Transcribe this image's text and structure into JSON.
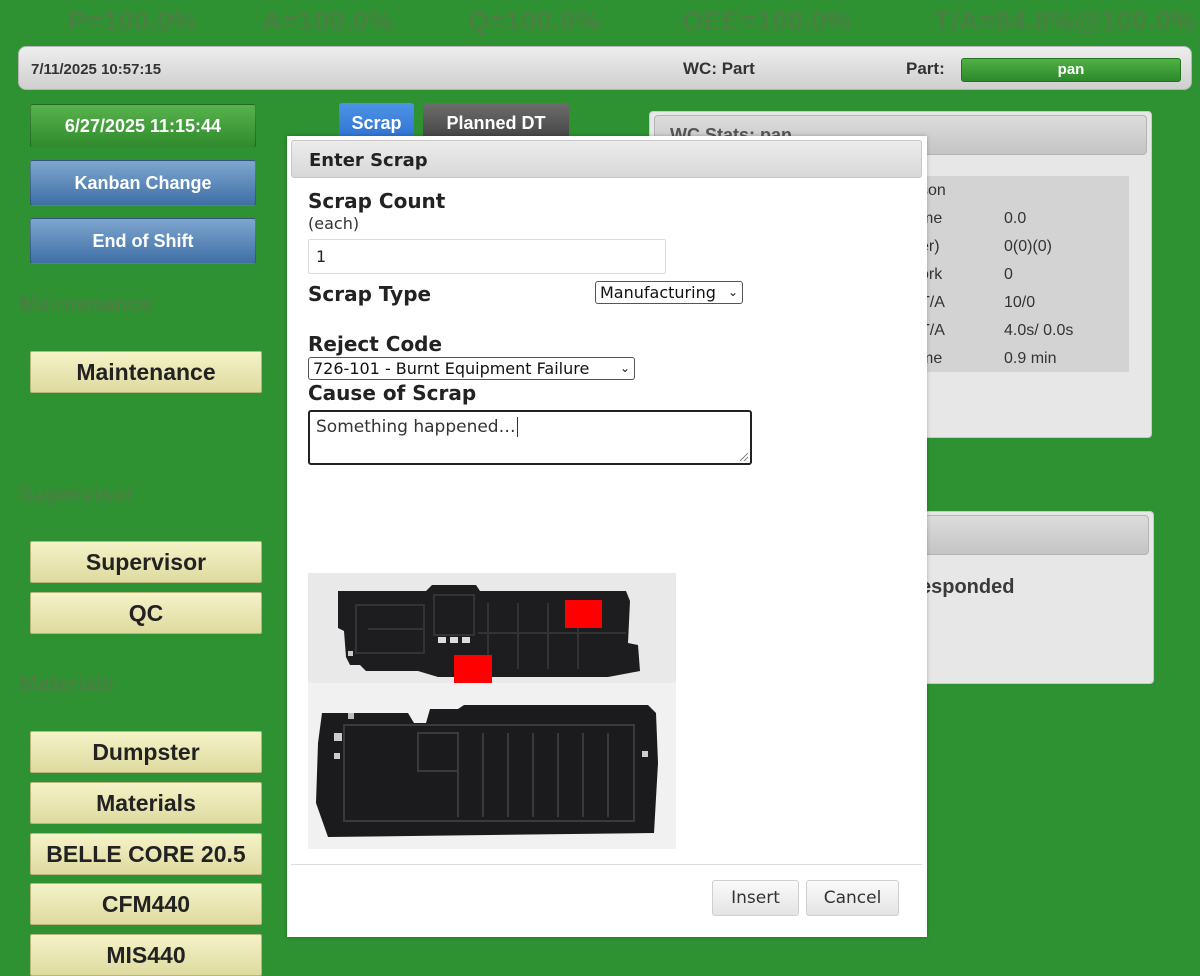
{
  "metrics": {
    "p": "P=100.0%",
    "a": "A=100.0%",
    "q": "Q=100.0%",
    "oee": "OEE=100.0%",
    "ta": "T/A=84.8%@100.0%"
  },
  "header": {
    "datetime": "7/11/2025 10:57:15",
    "wc": "WC:  Part",
    "part_label": "Part:",
    "part_value": "pan"
  },
  "left": {
    "timestamp_button": "6/27/2025 11:15:44",
    "kanban_button": "Kanban Change",
    "end_shift_button": "End of Shift",
    "maintenance_label": "Maintenance",
    "maintenance_button": "Maintenance",
    "supervisor_label": "Supervisor",
    "supervisor_button": "Supervisor",
    "qc_button": "QC",
    "materials_label": "Materials",
    "materials_buttons": [
      "Dumpster",
      "Materials",
      "BELLE CORE 20.5",
      "CFM440",
      "MIS440"
    ]
  },
  "tabs": {
    "scrap": "Scrap",
    "planned_dt": "Planned DT"
  },
  "stats_panel": {
    "title": "WC Stats: pan",
    "rows": [
      {
        "label": "son",
        "value": ""
      },
      {
        "label": "me",
        "value": "0.0"
      },
      {
        "label": "er)",
        "value": "0(0)(0)"
      },
      {
        "label": "ork",
        "value": "0"
      },
      {
        "label": "T/A",
        "value": "10/0"
      },
      {
        "label": "T/A",
        "value": "4.0s/ 0.0s"
      },
      {
        "label": "me",
        "value": "0.9 min"
      }
    ]
  },
  "second_panel": {
    "responded": "esponded"
  },
  "modal": {
    "title": "Enter Scrap",
    "scrap_count_label": "Scrap Count",
    "scrap_count_unit": "(each)",
    "scrap_count_value": "1",
    "scrap_type_label": "Scrap Type",
    "scrap_type_value": "Manufacturing",
    "reject_code_label": "Reject Code",
    "reject_code_value": "726-101 - Burnt Equipment Failure",
    "cause_label": "Cause of Scrap",
    "cause_value": "Something happened…",
    "insert_button": "Insert",
    "cancel_button": "Cancel"
  },
  "colors": {
    "background": "#2e9232",
    "marker": "#ff0000"
  }
}
